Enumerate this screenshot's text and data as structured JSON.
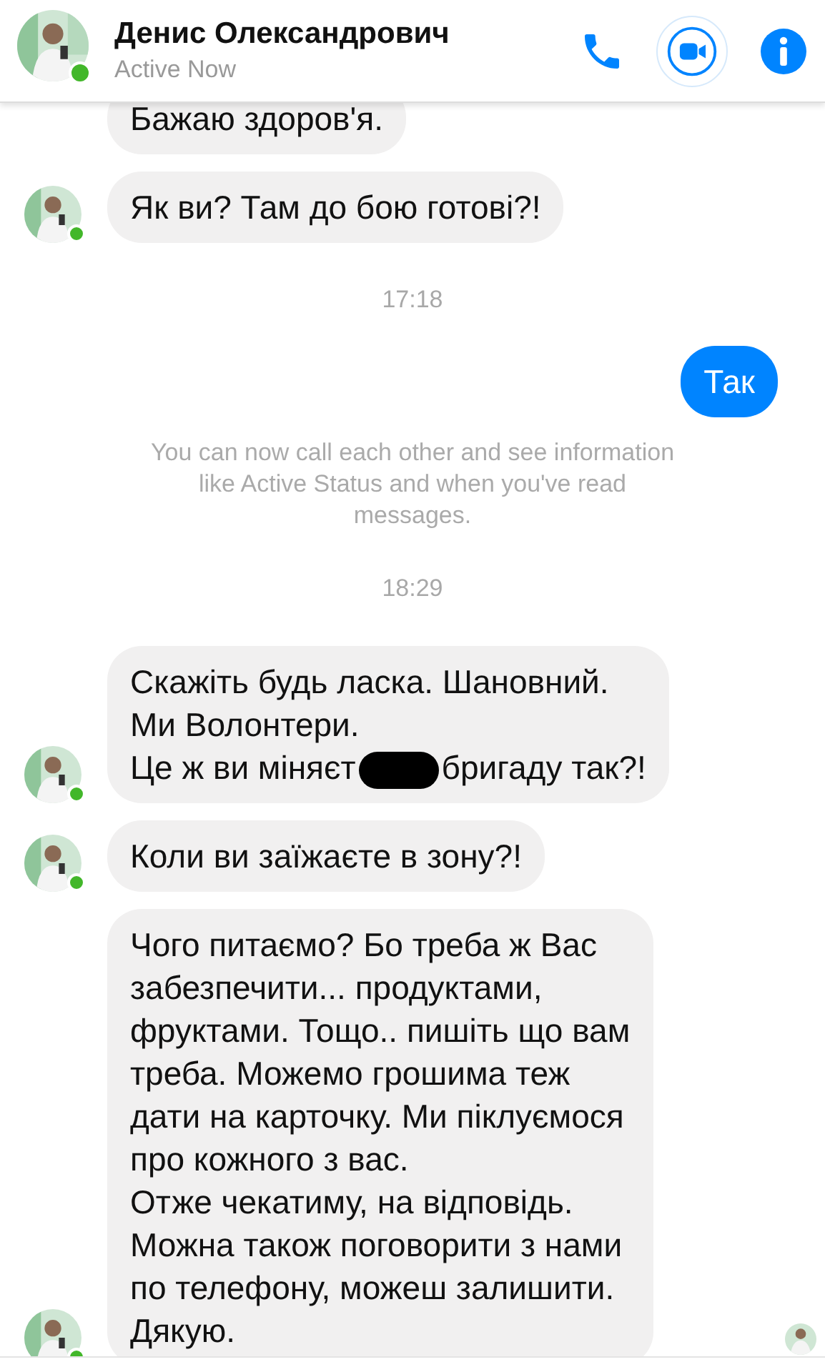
{
  "contact": {
    "name": "Денис Олександрович",
    "status": "Active Now",
    "online": true
  },
  "messages": [
    {
      "kind": "received",
      "avatar": false,
      "parts": [
        {
          "kind": "text",
          "text": "Бажаю здоров'я."
        }
      ]
    },
    {
      "kind": "received",
      "avatar": true,
      "parts": [
        {
          "kind": "text",
          "text": "Як ви? Там до бою готові?!"
        }
      ]
    },
    {
      "kind": "timestamp",
      "text": "17:18"
    },
    {
      "kind": "sent",
      "parts": [
        {
          "kind": "text",
          "text": "Так"
        }
      ]
    },
    {
      "kind": "notice",
      "text": "You can now call each other and see information\nlike Active Status and when you've read\nmessages."
    },
    {
      "kind": "timestamp",
      "text": "18:29"
    },
    {
      "kind": "received",
      "avatar": true,
      "parts": [
        {
          "kind": "text",
          "text": "Скажіть будь ласка. Шановний.\nМи Волонтери.\nЦе ж ви міняєт"
        },
        {
          "kind": "redaction"
        },
        {
          "kind": "text",
          "text": "бригаду так?!"
        }
      ]
    },
    {
      "kind": "received",
      "avatar": true,
      "parts": [
        {
          "kind": "text",
          "text": "Коли ви заїжаєте в зону?!"
        }
      ]
    },
    {
      "kind": "received",
      "avatar": true,
      "seen": true,
      "parts": [
        {
          "kind": "text",
          "text": "Чого питаємо? Бо треба ж Вас\nзабезпечити... продуктами,\nфруктами. Тощо.. пишіть що вам\nтреба. Можемо грошима теж\nдати на карточку. Ми піклуємося\nпро кожного з вас.\nОтже чекатиму, на відповідь.\nМожна також поговорити з нами\nпо телефону, можеш залишити.\nДякую."
        }
      ]
    }
  ]
}
